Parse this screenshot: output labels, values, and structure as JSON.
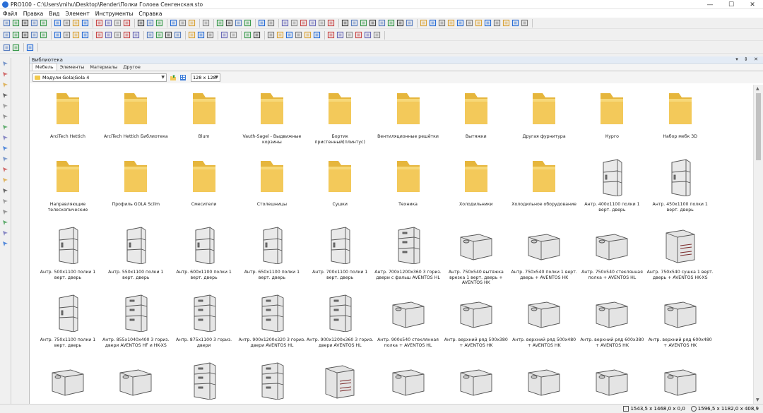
{
  "window": {
    "title": "PRO100 - C:\\Users\\mihu\\Desktop\\Render\\Полки Голоеа Сенгенская.sto",
    "minimize": "—",
    "maximize": "☐",
    "close": "✕"
  },
  "menu": [
    "Файл",
    "Правка",
    "Вид",
    "Элемент",
    "Инструменты",
    "Справка"
  ],
  "library": {
    "title": "Библиотека",
    "controls": "▾ ⇕ ✕",
    "tabs": [
      "Мебель",
      "Элементы",
      "Материалы",
      "Другое"
    ],
    "active_tab": 0,
    "path": "Модули Gola\\Gola 4",
    "thumb_size": "128 x 128",
    "items": [
      {
        "label": "ArciTech Hettich",
        "kind": "folder"
      },
      {
        "label": "ArciTech Hettich Библиотека",
        "kind": "folder"
      },
      {
        "label": "Blum",
        "kind": "folder"
      },
      {
        "label": "Vauth-Sagel - Выдвижные корзины",
        "kind": "folder"
      },
      {
        "label": "Бортик пристенный(плинтус)",
        "kind": "folder"
      },
      {
        "label": "Вентиляционные решётки",
        "kind": "folder"
      },
      {
        "label": "Вытяжки",
        "kind": "folder"
      },
      {
        "label": "Другая фурнитура",
        "kind": "folder"
      },
      {
        "label": "Курго",
        "kind": "folder"
      },
      {
        "label": "Набор мебк 3D",
        "kind": "folder"
      },
      {
        "label": "Направляющие телескопические",
        "kind": "folder"
      },
      {
        "label": "Профиль GOLA Scilm",
        "kind": "folder"
      },
      {
        "label": "Смесители",
        "kind": "folder"
      },
      {
        "label": "Столешницы",
        "kind": "folder"
      },
      {
        "label": "Сушки",
        "kind": "folder"
      },
      {
        "label": "Техника",
        "kind": "folder"
      },
      {
        "label": "Холодильники",
        "kind": "folder"
      },
      {
        "label": "Холодильное оборудование",
        "kind": "folder"
      },
      {
        "label": "Антр. 400x1100 полки 1 верт. дверь",
        "kind": "tall"
      },
      {
        "label": "Антр. 450x1100 полки 1 верт. дверь",
        "kind": "tall"
      },
      {
        "label": "Антр. 500x1100 полки 1 верт. дверь",
        "kind": "tall"
      },
      {
        "label": "Антр. 550x1100 полки 1 верт. дверь",
        "kind": "tall"
      },
      {
        "label": "Антр. 600x1100 полки 1 верт. дверь",
        "kind": "tall"
      },
      {
        "label": "Антр. 650x1100 полки 1 верт. дверь",
        "kind": "tall"
      },
      {
        "label": "Антр. 700x1100 полки 1 верт. дверь",
        "kind": "tall"
      },
      {
        "label": "Антр. 700x1200x360 3 гориз. двери с фальш AVENTOS HL",
        "kind": "tall3"
      },
      {
        "label": "Антр. 750x540 вытяжка врезка 1 верт. дверь + AVENTOS HK",
        "kind": "box"
      },
      {
        "label": "Антр. 750x540 полки 1 верт. дверь + AVENTOS HK",
        "kind": "box"
      },
      {
        "label": "Антр. 750x540 стеклянная полка + AVENTOS HL",
        "kind": "box"
      },
      {
        "label": "Антр. 750x540 сушка 1 верт. дверь + AVENTOS HK-XS",
        "kind": "boxdish"
      },
      {
        "label": "Антр. 750x1100 полки 1 верт. дверь",
        "kind": "tall"
      },
      {
        "label": "Антр. 855x1040x400 3 гориз. двери AVENTOS HF и HK-XS",
        "kind": "tall3"
      },
      {
        "label": "Антр. 875x1100 3 гориз. двери",
        "kind": "tall3"
      },
      {
        "label": "Антр. 900x1200x320 3 гориз. двери AVENTOS HL",
        "kind": "tall3"
      },
      {
        "label": "Антр. 900x1200x360 3 гориз. двери AVENTOS HL",
        "kind": "tall3"
      },
      {
        "label": "Антр. 900x540 стеклянная полка + AVENTOS HL",
        "kind": "box"
      },
      {
        "label": "Антр. верхний ряд 500x380 + AVENTOS HK",
        "kind": "box"
      },
      {
        "label": "Антр. верхний ряд 500x480 + AVENTOS HK",
        "kind": "box"
      },
      {
        "label": "Антр. верхний ряд 600x380 + AVENTOS HK",
        "kind": "box"
      },
      {
        "label": "Антр. верхний ряд 600x480 + AVENTOS HK",
        "kind": "box"
      },
      {
        "label": "",
        "kind": "box"
      },
      {
        "label": "",
        "kind": "box"
      },
      {
        "label": "",
        "kind": "tall3"
      },
      {
        "label": "",
        "kind": "tall3"
      },
      {
        "label": "",
        "kind": "boxdish"
      },
      {
        "label": "",
        "kind": "box"
      },
      {
        "label": "",
        "kind": "box"
      },
      {
        "label": "",
        "kind": "box"
      },
      {
        "label": "",
        "kind": "box"
      },
      {
        "label": "",
        "kind": "box"
      }
    ]
  },
  "status": {
    "size1": "1543,5 x 1468,0 x 0,0",
    "size2": "1596,5 x 1182,0 x 408,9"
  },
  "colors": {
    "folder": "#f3c95a",
    "folder_dark": "#e6b63c",
    "accent": "#2b6fd6"
  }
}
